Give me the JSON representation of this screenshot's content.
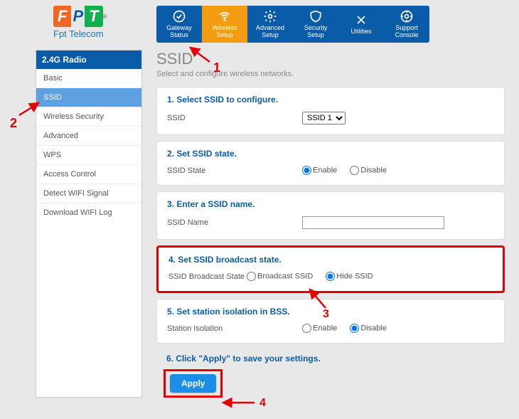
{
  "brand": {
    "telecom": "Fpt Telecom"
  },
  "nav": {
    "items": [
      {
        "label1": "Gateway",
        "label2": "Status"
      },
      {
        "label1": "Wireless",
        "label2": "Setup"
      },
      {
        "label1": "Advanced",
        "label2": "Setup"
      },
      {
        "label1": "Security",
        "label2": "Setup"
      },
      {
        "label1": "Utilities",
        "label2": ""
      },
      {
        "label1": "Support",
        "label2": "Console"
      }
    ]
  },
  "sidebar": {
    "header": "2.4G Radio",
    "items": [
      "Basic",
      "SSID",
      "Wireless Security",
      "Advanced",
      "WPS",
      "Access Control",
      "Detect WIFI Signal",
      "Download WIFI Log"
    ]
  },
  "page": {
    "title": "SSID",
    "subtitle": "Select and configure wireless networks."
  },
  "sections": {
    "s1": {
      "title": "1. Select SSID to configure.",
      "label": "SSID",
      "selected": "SSID 1"
    },
    "s2": {
      "title": "2. Set SSID state.",
      "label": "SSID State",
      "opt1": "Enable",
      "opt2": "Disable"
    },
    "s3": {
      "title": "3. Enter a SSID name.",
      "label": "SSID Name",
      "value": ""
    },
    "s4": {
      "title": "4. Set SSID broadcast state.",
      "label": "SSID Broadcast State",
      "opt1": "Broadcast SSID",
      "opt2": "Hide SSID"
    },
    "s5": {
      "title": "5. Set station isolation in BSS.",
      "label": "Station Isolation",
      "opt1": "Enable",
      "opt2": "Disable"
    },
    "s6": {
      "title": "6. Click \"Apply\" to save your settings.",
      "button": "Apply"
    }
  },
  "annotations": {
    "n1": "1",
    "n2": "2",
    "n3": "3",
    "n4": "4"
  }
}
